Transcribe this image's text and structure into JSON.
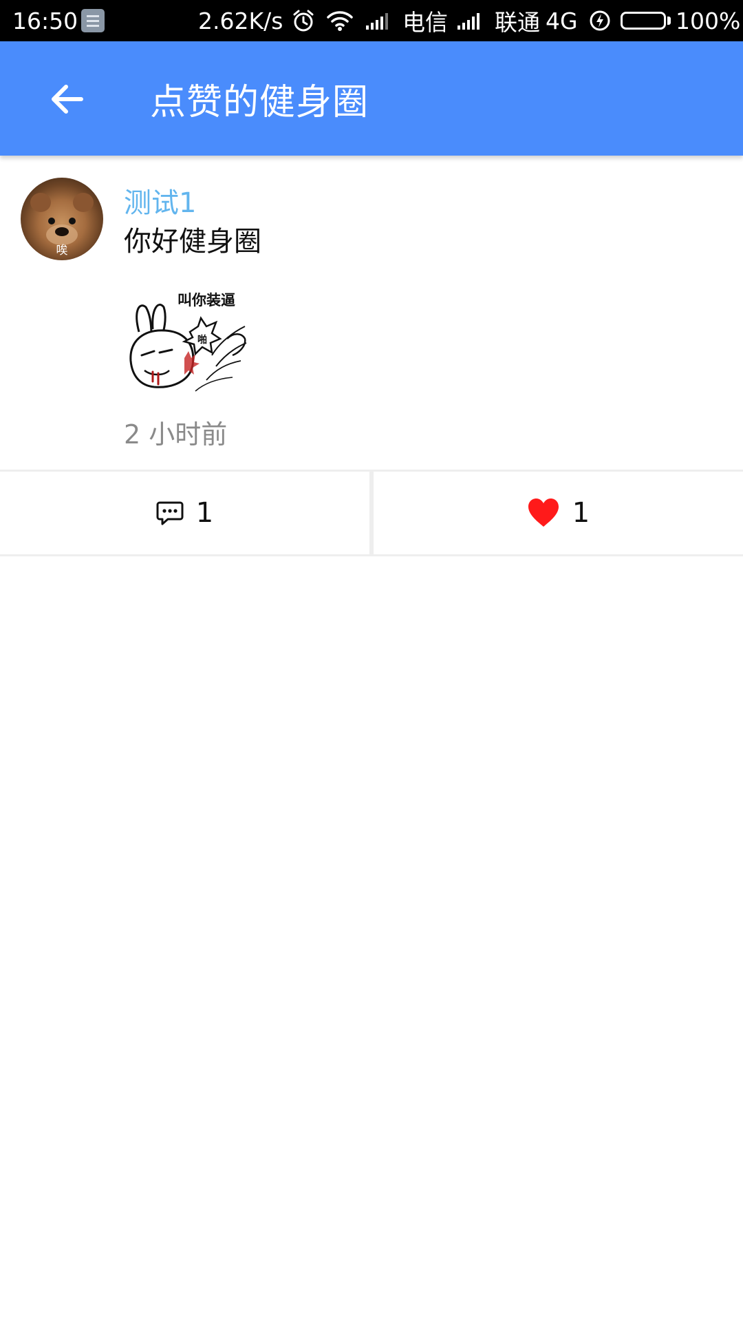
{
  "status_bar": {
    "time": "16:50",
    "net_speed": "2.62K/s",
    "carrier_1": "电信",
    "carrier_2": "联通",
    "network_type": "4G",
    "battery_percent": "100%",
    "battery_level": 1.0,
    "battery_color": "#52d60f",
    "icons": [
      "notification-icon",
      "alarm-icon",
      "wifi-icon",
      "signal-icon",
      "signal-icon",
      "charging-icon",
      "battery-icon"
    ]
  },
  "toolbar": {
    "title": "点赞的健身圈",
    "background": "#4a8cfc",
    "back_icon": "arrow-left-icon"
  },
  "post": {
    "avatar_caption": "唉",
    "user_name": "测试1",
    "user_name_color": "#62b5ee",
    "text": "你好健身圈",
    "image_caption": "叫你装逼",
    "image_onomatopoeia": "啪",
    "time": "2 小时前"
  },
  "actions": {
    "comment": {
      "icon": "comment-icon",
      "count": "1"
    },
    "like": {
      "icon": "heart-icon",
      "count": "1",
      "color": "#ff1a1a"
    }
  }
}
